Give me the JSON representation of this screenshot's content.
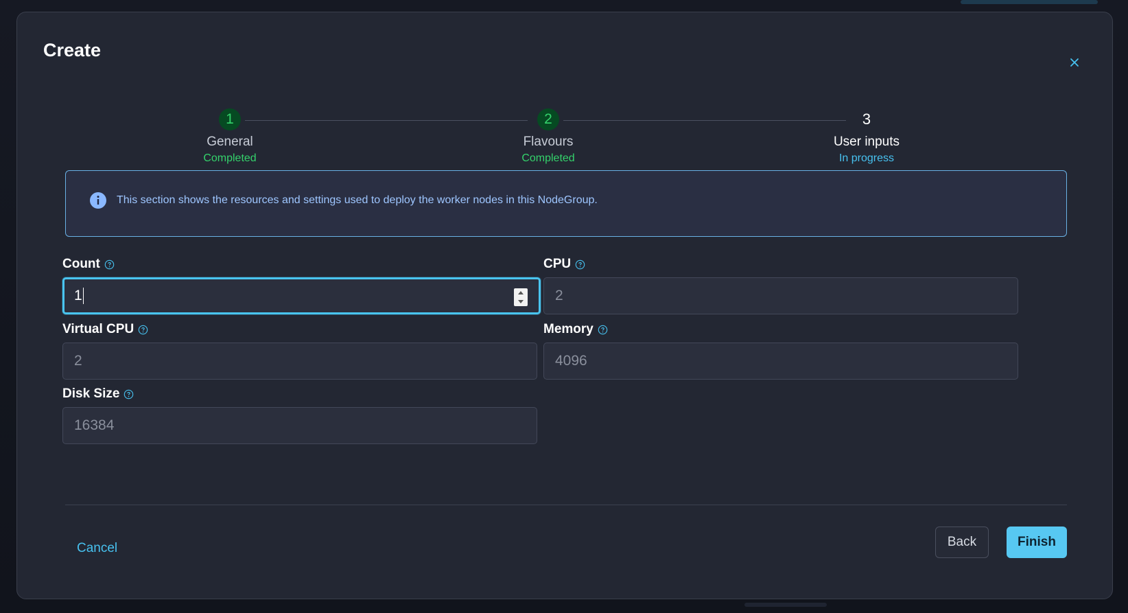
{
  "dialog": {
    "title": "Create"
  },
  "stepper": {
    "steps": [
      {
        "number": "1",
        "name": "General",
        "status": "Completed"
      },
      {
        "number": "2",
        "name": "Flavours",
        "status": "Completed"
      },
      {
        "number": "3",
        "name": "User inputs",
        "status": "In progress"
      }
    ],
    "colors": {
      "completed": "#34d26b",
      "in_progress": "#47c1ef"
    }
  },
  "info_banner": {
    "text": "This section shows the resources and settings used to deploy the worker nodes in this NodeGroup.",
    "icon": "info-icon"
  },
  "fields": {
    "count": {
      "label": "Count",
      "value": "1",
      "focused": true
    },
    "cpu": {
      "label": "CPU",
      "placeholder": "2"
    },
    "virtual_cpu": {
      "label": "Virtual CPU",
      "placeholder": "2"
    },
    "memory": {
      "label": "Memory",
      "placeholder": "4096"
    },
    "disk_size": {
      "label": "Disk Size",
      "placeholder": "16384"
    }
  },
  "footer": {
    "cancel_label": "Cancel",
    "back_label": "Back",
    "finish_label": "Finish"
  },
  "accent_color": "#57c8f2"
}
